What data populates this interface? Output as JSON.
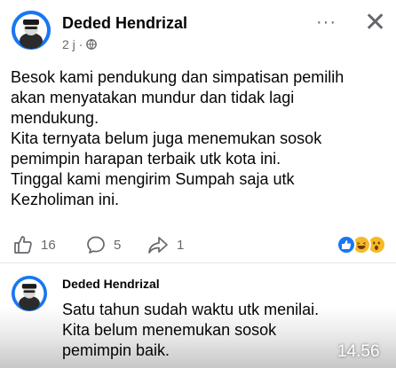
{
  "post": {
    "author": "Deded Hendrizal",
    "time": "2 j ·",
    "privacy_icon": "globe-icon",
    "lines": [
      "Besok kami pendukung dan simpatisan pemilih",
      "akan menyatakan mundur dan tidak lagi",
      "mendukung.",
      "Kita ternyata belum juga menemukan sosok",
      "pemimpin harapan terbaik utk kota ini.",
      "Tinggal kami mengirim Sumpah saja utk",
      "Kezholiman ini."
    ]
  },
  "header": {
    "more_label": "···",
    "close_label": "✕"
  },
  "actions": {
    "like_count": "16",
    "comment_count": "5",
    "share_count": "1"
  },
  "reactions": [
    "like-icon",
    "haha-icon",
    "wow-icon"
  ],
  "comment": {
    "author": "Deded Hendrizal",
    "lines": [
      "Satu tahun sudah waktu utk menilai.",
      "Kita belum menemukan sosok",
      "pemimpin baik."
    ]
  },
  "status": {
    "time": "14.56"
  },
  "colors": {
    "accent": "#1877f2",
    "muted": "#65676b"
  }
}
